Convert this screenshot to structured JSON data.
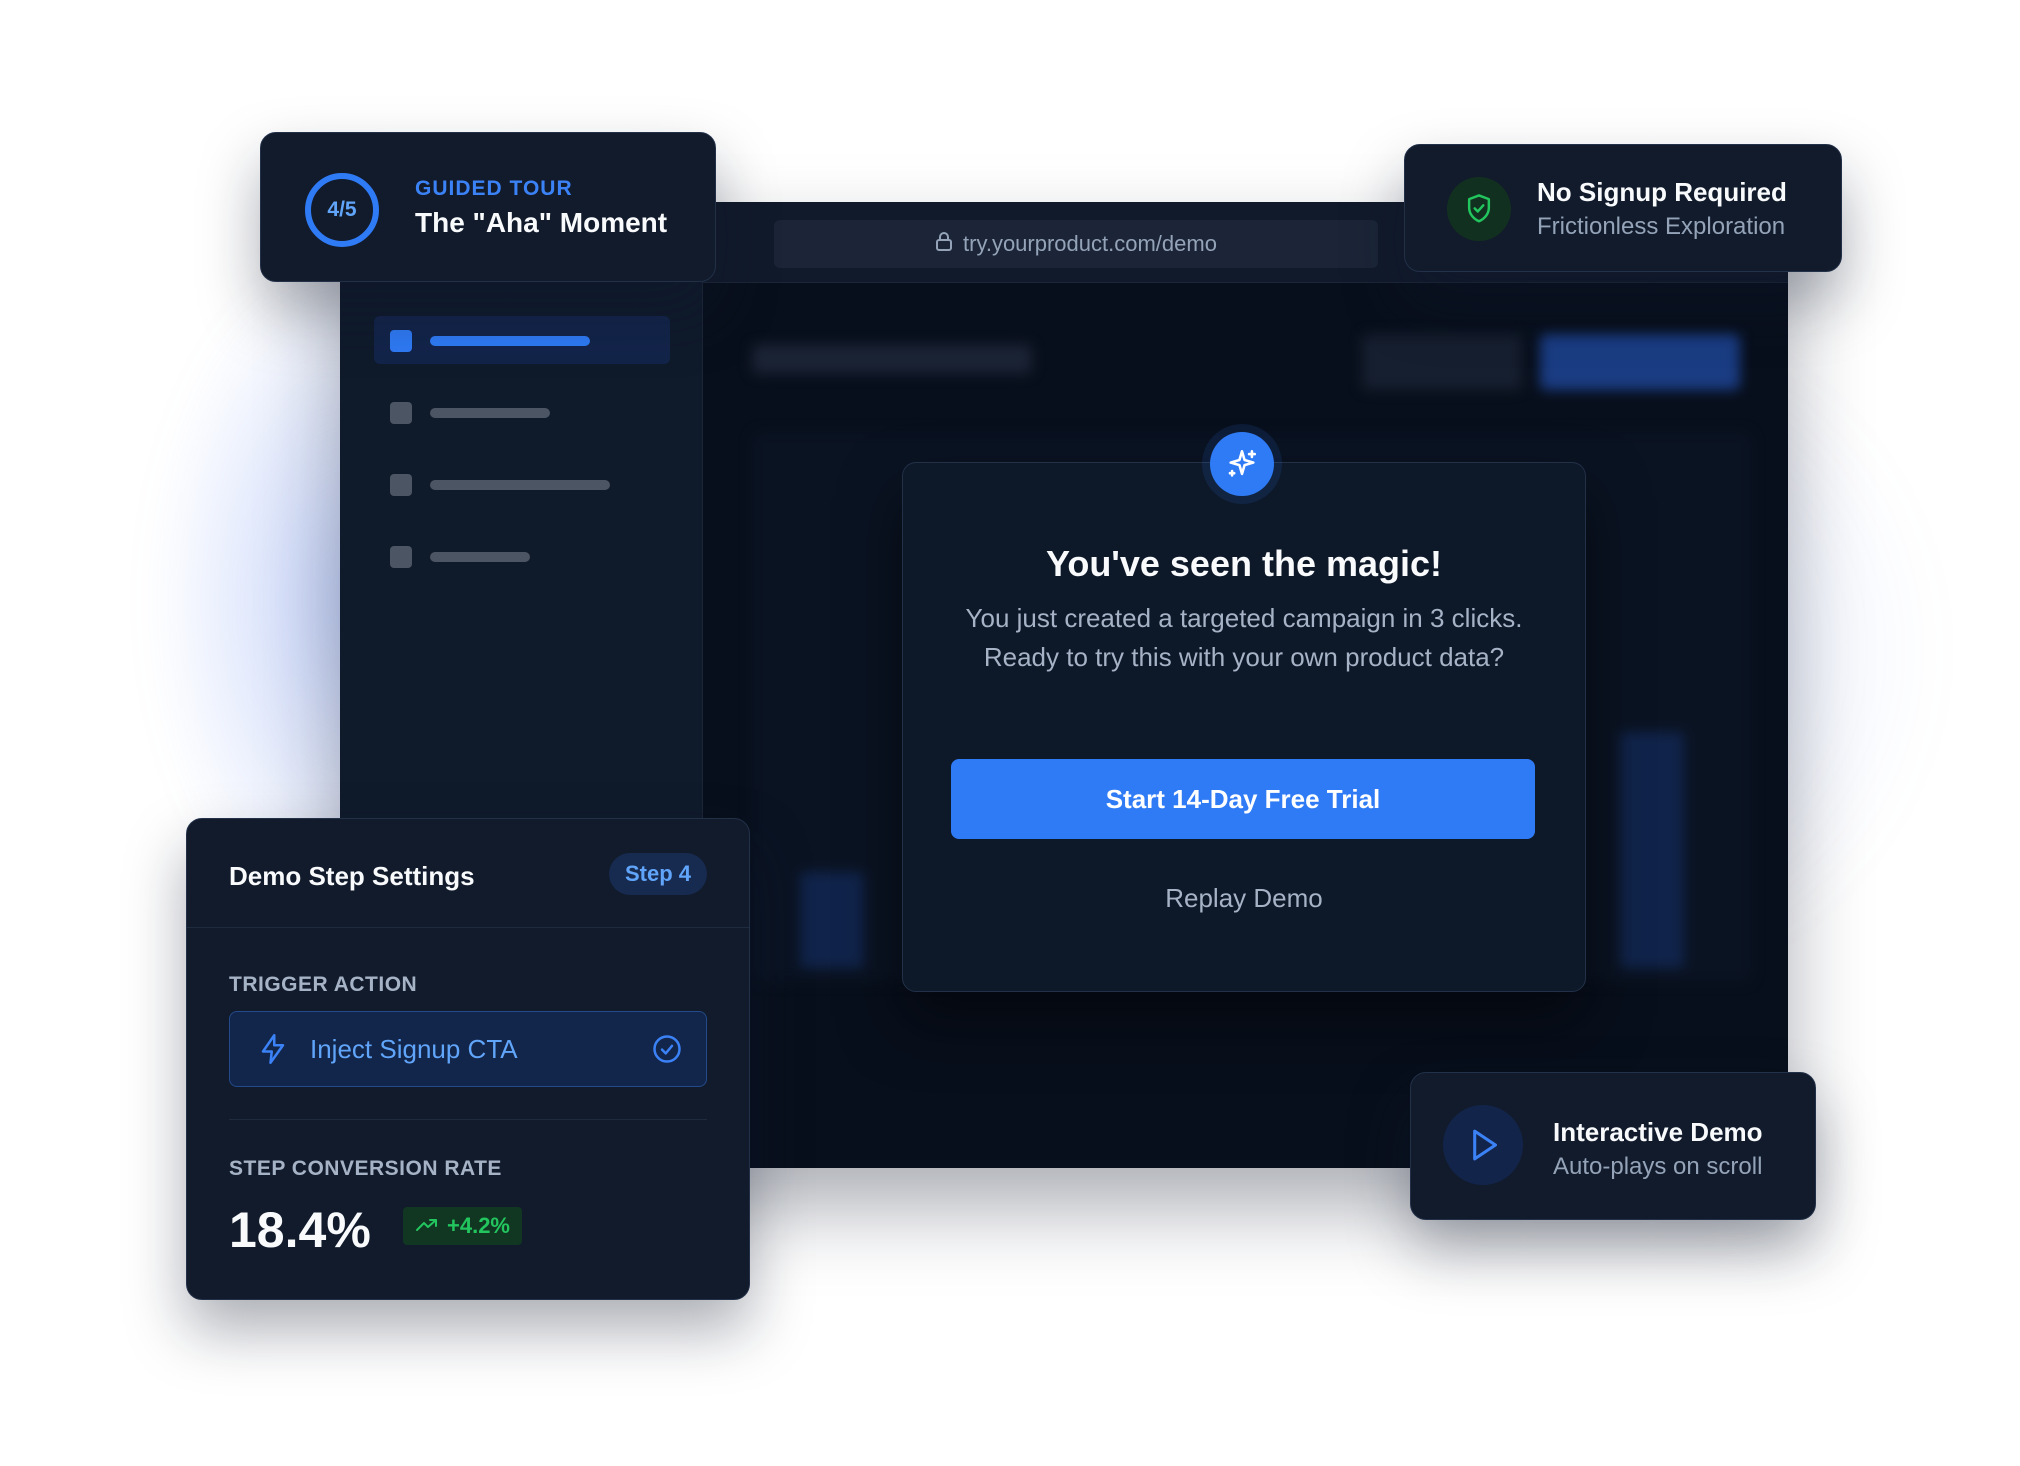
{
  "browser": {
    "url": "try.yourproduct.com/demo",
    "lock_icon": "lock-icon"
  },
  "modal": {
    "icon": "sparkles-icon",
    "title": "You've seen the magic!",
    "body": "You just created a targeted campaign in 3 clicks. Ready to try this with your own product data?",
    "cta_label": "Start 14-Day Free Trial",
    "replay_label": "Replay Demo"
  },
  "tour_card": {
    "progress": "4/5",
    "kicker": "GUIDED TOUR",
    "title": "The \"Aha\" Moment"
  },
  "signup_card": {
    "icon": "shield-check-icon",
    "title": "No Signup Required",
    "subtitle": "Frictionless Exploration"
  },
  "settings_card": {
    "title": "Demo Step Settings",
    "step_badge": "Step 4",
    "trigger_label": "TRIGGER ACTION",
    "trigger_value": "Inject Signup CTA",
    "conversion_label": "STEP CONVERSION RATE",
    "conversion_value": "18.4%",
    "conversion_delta": "+4.2%"
  },
  "demo_card": {
    "icon": "play-icon",
    "title": "Interactive Demo",
    "subtitle": "Auto-plays on scroll"
  },
  "colors": {
    "accent": "#2f7bf6",
    "success": "#22c55e",
    "surface": "#111b2c",
    "background": "#080f1c"
  }
}
